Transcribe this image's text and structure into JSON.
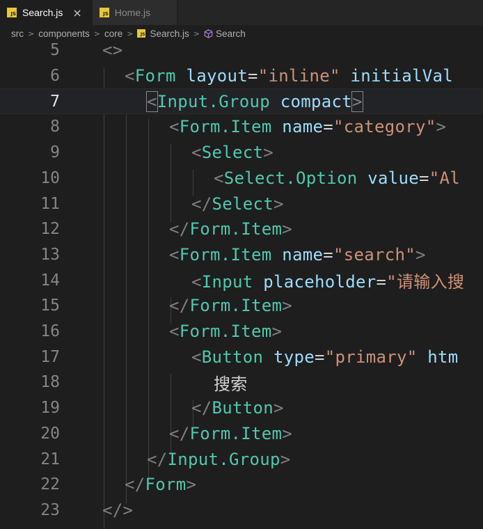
{
  "tabs": [
    {
      "label": "Search.js",
      "icon": "js-file-icon",
      "badge": "JS",
      "active": true,
      "close": "×"
    },
    {
      "label": "Home.js",
      "icon": "js-file-icon",
      "badge": "JS",
      "active": false
    }
  ],
  "breadcrumb": [
    "src",
    "components",
    "core",
    "Search.js",
    "Search"
  ],
  "breadcrumb_separator": ">",
  "breadcrumb_badge": "JS",
  "editor": {
    "current_line": "7",
    "lines": [
      {
        "n": "5",
        "tokens": [
          [
            "p",
            "<>"
          ]
        ]
      },
      {
        "n": "6",
        "tokens": [
          [
            "p",
            "<"
          ],
          [
            "t",
            "Form"
          ],
          [
            "x",
            " "
          ],
          [
            "a",
            "layout"
          ],
          [
            "e",
            "="
          ],
          [
            "s",
            "\"inline\""
          ],
          [
            "x",
            " "
          ],
          [
            "a",
            "initialVal"
          ]
        ]
      },
      {
        "n": "7",
        "tokens": [
          [
            "p",
            "<"
          ],
          [
            "t",
            "Input.Group"
          ],
          [
            "x",
            " "
          ],
          [
            "a",
            "compact"
          ],
          [
            "p",
            ">"
          ]
        ]
      },
      {
        "n": "8",
        "tokens": [
          [
            "p",
            "<"
          ],
          [
            "t",
            "Form.Item"
          ],
          [
            "x",
            " "
          ],
          [
            "a",
            "name"
          ],
          [
            "e",
            "="
          ],
          [
            "s",
            "\"category\""
          ],
          [
            "p",
            ">"
          ]
        ]
      },
      {
        "n": "9",
        "tokens": [
          [
            "p",
            "<"
          ],
          [
            "t",
            "Select"
          ],
          [
            "p",
            ">"
          ]
        ]
      },
      {
        "n": "10",
        "tokens": [
          [
            "p",
            "<"
          ],
          [
            "t",
            "Select.Option"
          ],
          [
            "x",
            " "
          ],
          [
            "a",
            "value"
          ],
          [
            "e",
            "="
          ],
          [
            "s",
            "\"Al"
          ]
        ]
      },
      {
        "n": "11",
        "tokens": [
          [
            "p",
            "</"
          ],
          [
            "t",
            "Select"
          ],
          [
            "p",
            ">"
          ]
        ]
      },
      {
        "n": "12",
        "tokens": [
          [
            "p",
            "</"
          ],
          [
            "t",
            "Form.Item"
          ],
          [
            "p",
            ">"
          ]
        ]
      },
      {
        "n": "13",
        "tokens": [
          [
            "p",
            "<"
          ],
          [
            "t",
            "Form.Item"
          ],
          [
            "x",
            " "
          ],
          [
            "a",
            "name"
          ],
          [
            "e",
            "="
          ],
          [
            "s",
            "\"search\""
          ],
          [
            "p",
            ">"
          ]
        ]
      },
      {
        "n": "14",
        "tokens": [
          [
            "p",
            "<"
          ],
          [
            "t",
            "Input"
          ],
          [
            "x",
            " "
          ],
          [
            "a",
            "placeholder"
          ],
          [
            "e",
            "="
          ],
          [
            "s",
            "\"请输入搜"
          ]
        ]
      },
      {
        "n": "15",
        "tokens": [
          [
            "p",
            "</"
          ],
          [
            "t",
            "Form.Item"
          ],
          [
            "p",
            ">"
          ]
        ]
      },
      {
        "n": "16",
        "tokens": [
          [
            "p",
            "<"
          ],
          [
            "t",
            "Form.Item"
          ],
          [
            "p",
            ">"
          ]
        ]
      },
      {
        "n": "17",
        "tokens": [
          [
            "p",
            "<"
          ],
          [
            "t",
            "Button"
          ],
          [
            "x",
            " "
          ],
          [
            "a",
            "type"
          ],
          [
            "e",
            "="
          ],
          [
            "s",
            "\"primary\""
          ],
          [
            "x",
            " "
          ],
          [
            "a",
            "htm"
          ]
        ]
      },
      {
        "n": "18",
        "tokens": [
          [
            "x",
            "搜索"
          ]
        ]
      },
      {
        "n": "19",
        "tokens": [
          [
            "p",
            "</"
          ],
          [
            "t",
            "Button"
          ],
          [
            "p",
            ">"
          ]
        ]
      },
      {
        "n": "20",
        "tokens": [
          [
            "p",
            "</"
          ],
          [
            "t",
            "Form.Item"
          ],
          [
            "p",
            ">"
          ]
        ]
      },
      {
        "n": "21",
        "tokens": [
          [
            "p",
            "</"
          ],
          [
            "t",
            "Input.Group"
          ],
          [
            "p",
            ">"
          ]
        ]
      },
      {
        "n": "22",
        "tokens": [
          [
            "p",
            "</"
          ],
          [
            "t",
            "Form"
          ],
          [
            "p",
            ">"
          ]
        ]
      },
      {
        "n": "23",
        "tokens": [
          [
            "p",
            "</>"
          ]
        ]
      }
    ]
  },
  "colors": {
    "background": "#1e1e1e",
    "tag": "#4ec9b0",
    "attribute": "#9cdcfe",
    "string": "#ce9178",
    "punctuation": "#808080"
  }
}
